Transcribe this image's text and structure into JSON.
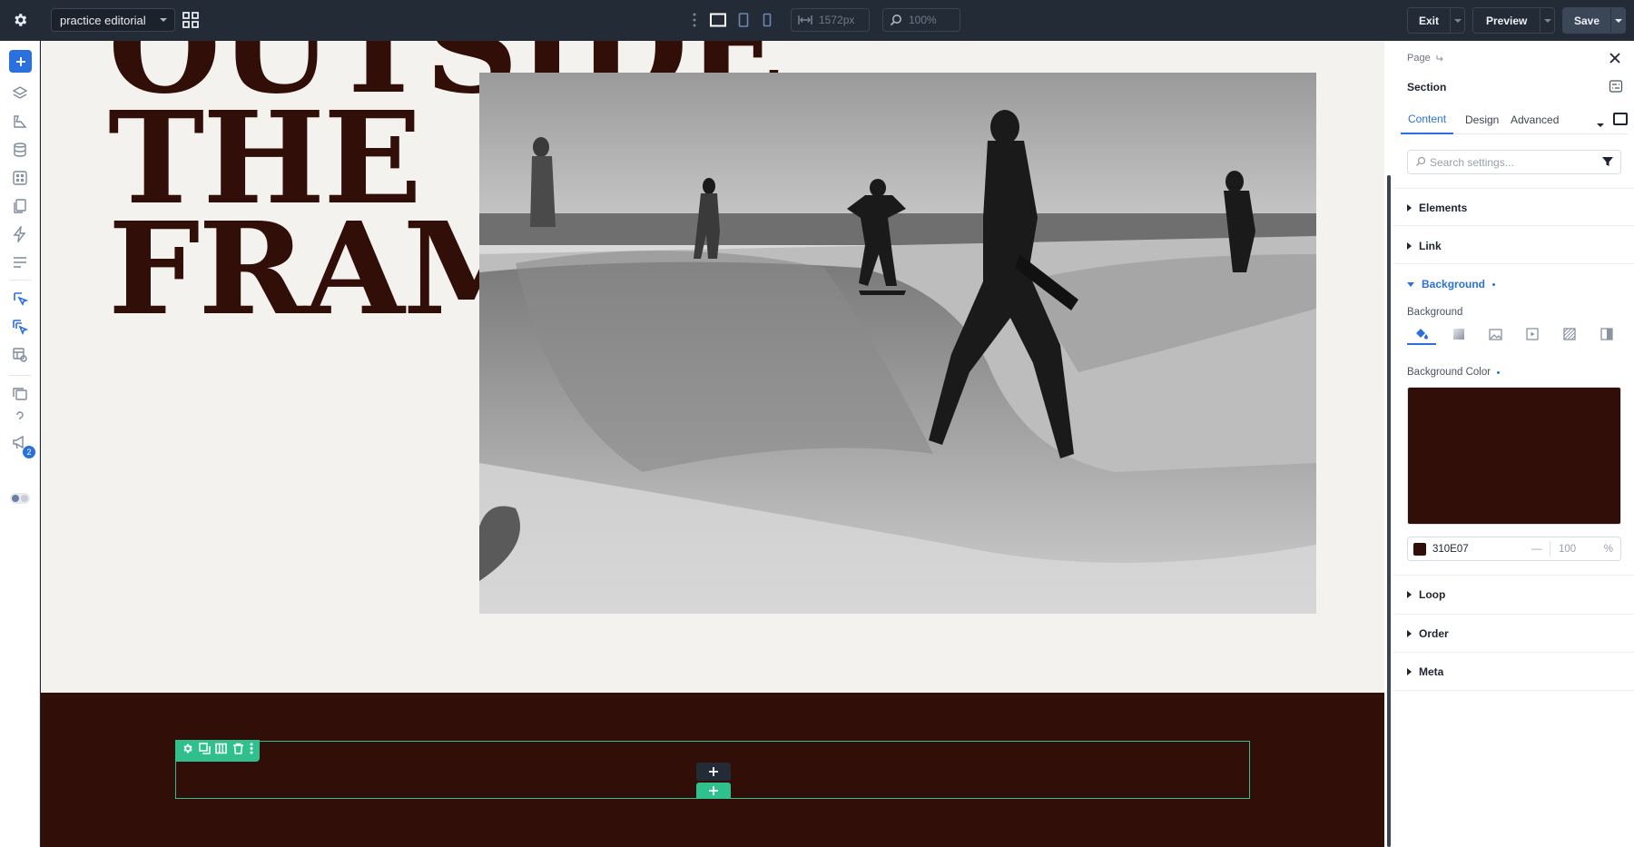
{
  "topbar": {
    "page_name": "practice editorial",
    "width_value": "1572px",
    "zoom_value": "100%",
    "exit_label": "Exit",
    "preview_label": "Preview",
    "save_label": "Save"
  },
  "leftbar": {
    "notification_count": "2"
  },
  "canvas": {
    "headline_partial": "OUTSIDE",
    "headline_line1": "THE",
    "headline_line2": "FRAME",
    "text_color": "#310E07",
    "section_bg": "#310E07"
  },
  "panel": {
    "breadcrumb": "Page",
    "section_title": "Section",
    "tabs": [
      "Content",
      "Design",
      "Advanced"
    ],
    "search_placeholder": "Search settings...",
    "accordions": {
      "elements": "Elements",
      "link": "Link",
      "background": "Background",
      "loop": "Loop",
      "order": "Order",
      "meta": "Meta"
    },
    "background_label": "Background",
    "background_color_label": "Background Color",
    "color_hex": "310E07",
    "opacity_value": "100",
    "opacity_unit": "%",
    "dash": "—"
  },
  "colors": {
    "accent": "#2A70DE",
    "selection": "#2FC08E",
    "topbar": "#232B37"
  }
}
